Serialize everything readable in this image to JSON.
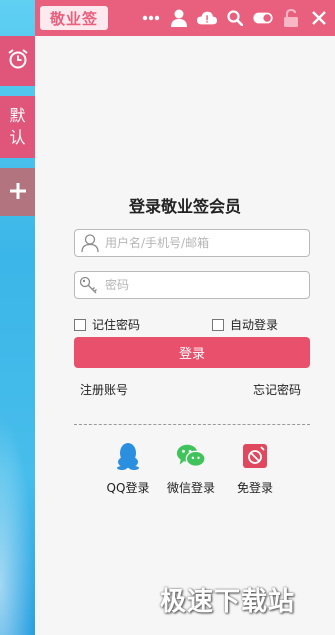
{
  "topbar": {
    "logo_label": "敬业签",
    "icons": [
      "more-icon",
      "user-icon",
      "cloud-warning-icon",
      "search-icon",
      "toggle-icon",
      "lock-icon",
      "close-icon"
    ]
  },
  "sidebar": {
    "items": [
      {
        "icon": "alarm-clock-icon"
      },
      {
        "label_line1": "默",
        "label_line2": "认"
      },
      {
        "icon": "plus-icon"
      }
    ]
  },
  "login": {
    "title": "登录敬业签会员",
    "username_placeholder": "用户名/手机号/邮箱",
    "password_placeholder": "密码",
    "remember_label": "记住密码",
    "auto_login_label": "自动登录",
    "login_button": "登录",
    "register_link": "注册账号",
    "forgot_link": "忘记密码",
    "alt_logins": [
      {
        "label": "QQ登录",
        "icon": "qq-penguin-icon",
        "color": "#2b8fe0"
      },
      {
        "label": "微信登录",
        "icon": "wechat-icon",
        "color": "#3fc35a"
      },
      {
        "label": "免登录",
        "icon": "guest-icon",
        "color": "#e0485e"
      }
    ]
  },
  "watermark": "极速下载站",
  "colors": {
    "accent": "#e9607e",
    "button": "#e9506b",
    "panel_bg": "#f6f6f6"
  }
}
